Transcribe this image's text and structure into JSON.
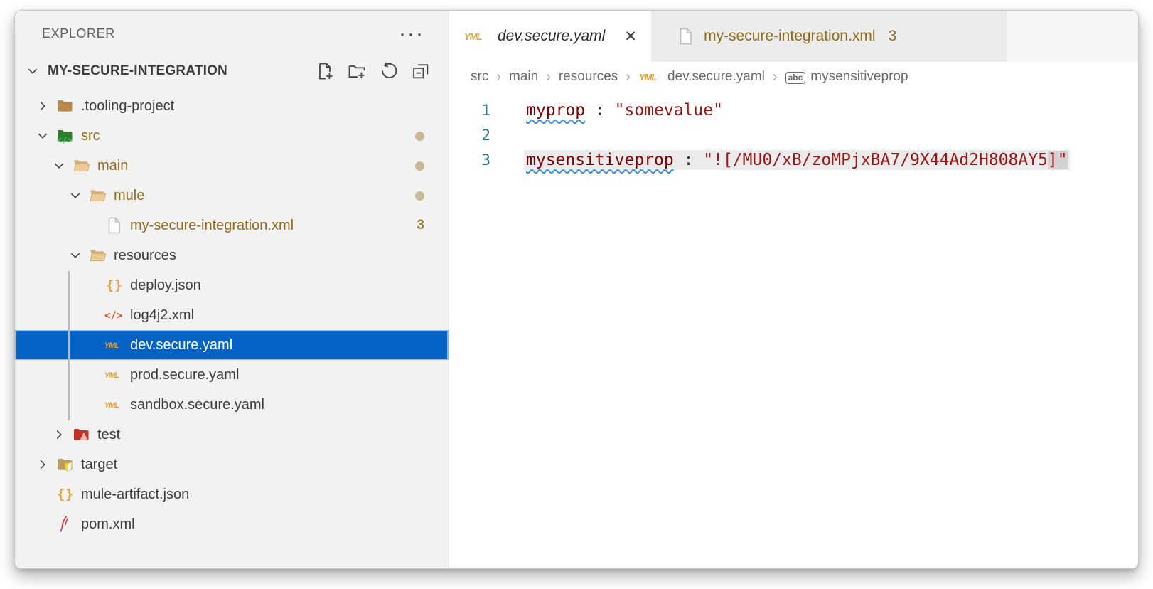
{
  "explorer": {
    "title": "EXPLORER",
    "more_actions_icon": "ellipsis-icon",
    "root": {
      "name": "MY-SECURE-INTEGRATION",
      "chevron": "down",
      "actions": [
        {
          "name": "new-file-button",
          "icon": "new-file-icon"
        },
        {
          "name": "new-folder-button",
          "icon": "new-folder-icon"
        },
        {
          "name": "refresh-explorer-button",
          "icon": "refresh-icon"
        },
        {
          "name": "collapse-folders-button",
          "icon": "collapse-all-icon"
        }
      ]
    },
    "tree": [
      {
        "label": ".tooling-project",
        "level": 1,
        "icon": "folder-tan-icon",
        "chevron": "right"
      },
      {
        "label": "src",
        "level": 1,
        "icon": "folder-src-icon",
        "chevron": "down",
        "modified": true,
        "badge": "dot"
      },
      {
        "label": "main",
        "level": 2,
        "icon": "folder-open-icon",
        "chevron": "down",
        "modified": true,
        "badge": "dot"
      },
      {
        "label": "mule",
        "level": 3,
        "icon": "folder-open-icon",
        "chevron": "down",
        "modified": true,
        "badge": "dot"
      },
      {
        "label": "my-secure-integration.xml",
        "level": 4,
        "icon": "file-plain-icon",
        "modified": true,
        "badge": "3"
      },
      {
        "label": "resources",
        "level": 3,
        "icon": "folder-open-icon",
        "chevron": "down"
      },
      {
        "label": "deploy.json",
        "level": 4,
        "icon": "json-icon"
      },
      {
        "label": "log4j2.xml",
        "level": 4,
        "icon": "xml-code-icon"
      },
      {
        "label": "dev.secure.yaml",
        "level": 4,
        "icon": "yaml-icon",
        "selected": true
      },
      {
        "label": "prod.secure.yaml",
        "level": 4,
        "icon": "yaml-icon"
      },
      {
        "label": "sandbox.secure.yaml",
        "level": 4,
        "icon": "yaml-icon"
      },
      {
        "label": "test",
        "level": 2,
        "icon": "folder-test-icon",
        "chevron": "right"
      },
      {
        "label": "target",
        "level": 1,
        "icon": "folder-target-icon",
        "chevron": "right"
      },
      {
        "label": "mule-artifact.json",
        "level": 1,
        "icon": "json-icon"
      },
      {
        "label": "pom.xml",
        "level": 1,
        "icon": "maven-icon"
      }
    ]
  },
  "editor": {
    "tabs": [
      {
        "label": "dev.secure.yaml",
        "icon": "yaml-icon",
        "active": true,
        "preview_italic": true,
        "close_label": "✕"
      },
      {
        "label": "my-secure-integration.xml",
        "icon": "file-plain-icon",
        "active": false,
        "badge": "3"
      }
    ],
    "breadcrumb": [
      {
        "label": "src"
      },
      {
        "label": "main"
      },
      {
        "label": "resources"
      },
      {
        "label": "dev.secure.yaml",
        "icon": "yaml-icon"
      },
      {
        "label": "mysensitiveprop",
        "icon": "abc-icon"
      }
    ],
    "breadcrumb_separator": "›",
    "code_lines": [
      {
        "number": "1",
        "highlight": false,
        "tokens": [
          {
            "text": "myprop",
            "type": "key",
            "squiggle": true
          },
          {
            "text": " : ",
            "type": "punct"
          },
          {
            "text": "\"somevalue\"",
            "type": "string"
          }
        ]
      },
      {
        "number": "2",
        "highlight": false,
        "tokens": []
      },
      {
        "number": "3",
        "highlight": true,
        "tokens": [
          {
            "text": "mysensitiveprop",
            "type": "key",
            "squiggle": true
          },
          {
            "text": " : ",
            "type": "punct"
          },
          {
            "text": "\"![/MU0/xB/zoMPjxBA7/9X44Ad2H808AY5",
            "type": "string"
          },
          {
            "text": "]\"",
            "type": "string",
            "cursorbox": true
          }
        ]
      }
    ]
  },
  "colors": {
    "sidebar_bg": "#F2F2F2",
    "selection_bg": "#0663C6",
    "selection_border": "#83B8F0",
    "modified_gold": "#8E6B1D",
    "badge_dot": "#C9BA97",
    "yaml_key": "#800000",
    "yaml_string": "#A31515",
    "line_number": "#237893",
    "squiggle_underline": "#3E8FE0",
    "line_highlight": "#EBEBEB",
    "cursor_box": "#D2D2D2",
    "yaml_icon_gold": "#D9A13F"
  }
}
